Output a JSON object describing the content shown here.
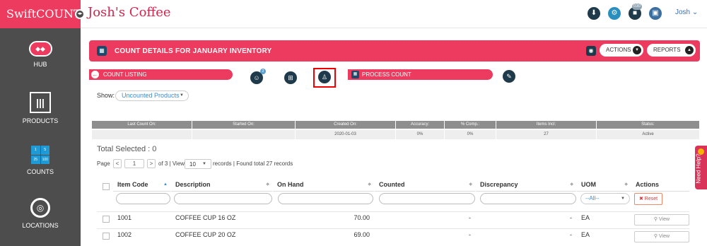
{
  "app": {
    "brand": "SwiftCOUNT",
    "store_name": "Josh's Coffee"
  },
  "topbar": {
    "badge": "030",
    "user": "Josh",
    "user_caret": "⌄"
  },
  "sidebar": {
    "items": [
      {
        "label": "HUB",
        "icon": "hub-icon"
      },
      {
        "label": "PRODUCTS",
        "icon": "barcode-icon"
      },
      {
        "label": "COUNTS",
        "icon": "counts-icon",
        "tiles": [
          "1",
          "5",
          "25",
          "100"
        ]
      },
      {
        "label": "LOCATIONS",
        "icon": "location-icon"
      }
    ]
  },
  "header": {
    "title": "COUNT DETAILS FOR JANUARY INVENTORY",
    "actions_label": "ACTIONS",
    "reports_label": "REPORTS"
  },
  "steps": {
    "count_listing_label": "COUNT LISTING",
    "process_count_label": "PROCESS COUNT",
    "step_badge": "2"
  },
  "filter": {
    "show_label": "Show:",
    "show_value": "Uncounted Products"
  },
  "summary": {
    "headers": [
      "Last Count On:",
      "Started On:",
      "Created On:",
      "Accuracy:",
      "% Comp.:",
      "Items Incl:",
      "Status:"
    ],
    "values": [
      "",
      "",
      "2020-01-03",
      "0%",
      "0%",
      "27",
      "Active"
    ]
  },
  "total": {
    "label": "Total Selected :",
    "value": "0"
  },
  "pager": {
    "page_label": "Page",
    "page": "1",
    "of_pages": "of 3 | View",
    "per_page": "10",
    "records": "records | Found total 27 records",
    "prev": "<",
    "next": ">"
  },
  "table": {
    "columns": [
      "Item Code",
      "Description",
      "On Hand",
      "Counted",
      "Discrepancy",
      "UOM",
      "Actions"
    ],
    "uom_filter": "--All--",
    "reset_label": "Reset",
    "rows": [
      {
        "code": "1001",
        "description": "COFFEE CUP 16 OZ",
        "on_hand": "70.00",
        "counted": "-",
        "discrepancy": "-",
        "uom": "EA",
        "action": "View"
      },
      {
        "code": "1002",
        "description": "COFFEE CUP 20 OZ",
        "on_hand": "69.00",
        "counted": "-",
        "discrepancy": "-",
        "uom": "EA",
        "action": "View"
      }
    ]
  },
  "help": {
    "label": "Need Help?"
  },
  "colors": {
    "brand": "#ec3b5e",
    "sidebar": "#4d4d4d",
    "dark_icon": "#1f3a4a"
  }
}
